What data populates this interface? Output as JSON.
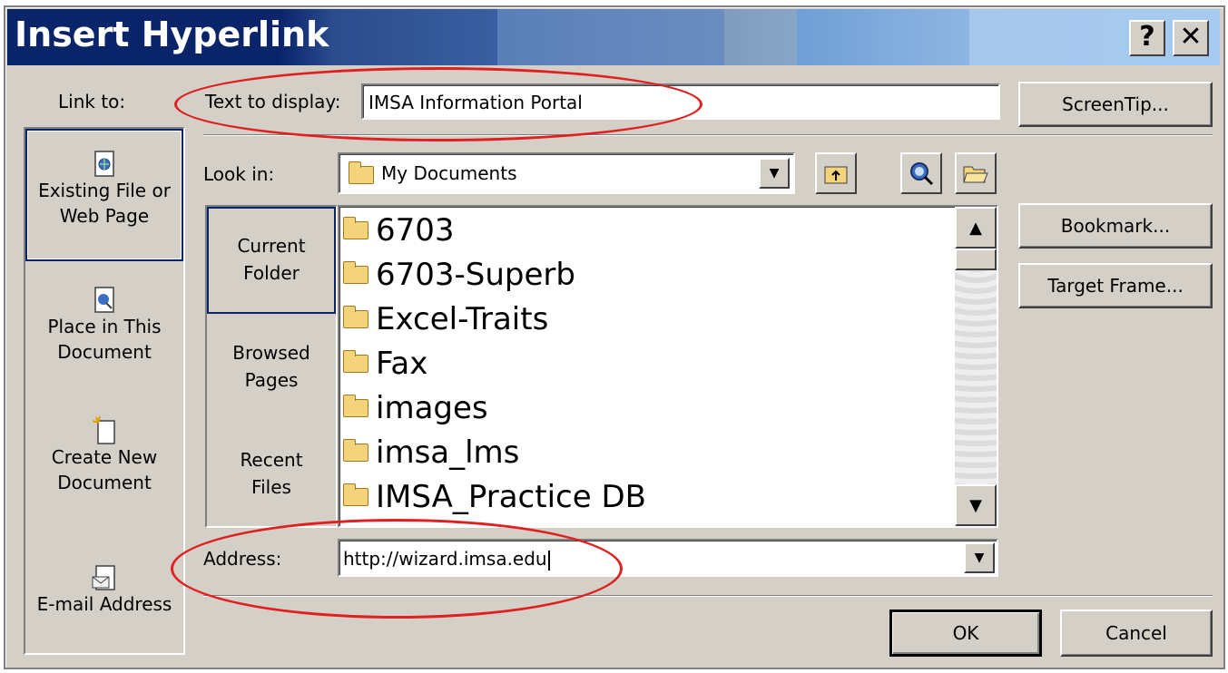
{
  "window": {
    "title": "Insert Hyperlink",
    "help_button": "?",
    "close_button": "✕"
  },
  "link_to": {
    "label": "Link to:",
    "items": [
      {
        "line1": "Existing File or",
        "line2": "Web Page",
        "icon": "web-page-icon",
        "selected": true
      },
      {
        "line1": "Place in This",
        "line2": "Document",
        "icon": "place-in-document-icon",
        "selected": false
      },
      {
        "line1": "Create New",
        "line2": "Document",
        "icon": "new-document-icon",
        "selected": false
      },
      {
        "line1": "E-mail Address",
        "line2": "",
        "icon": "email-icon",
        "selected": false
      }
    ]
  },
  "text_to_display": {
    "label": "Text to display:",
    "value": "IMSA Information Portal"
  },
  "look_in": {
    "label": "Look in:",
    "value": "My Documents"
  },
  "nav": {
    "items": [
      {
        "line1": "Current",
        "line2": "Folder",
        "selected": true
      },
      {
        "line1": "Browsed",
        "line2": "Pages",
        "selected": false
      },
      {
        "line1": "Recent",
        "line2": "Files",
        "selected": false
      }
    ]
  },
  "files": [
    "6703",
    "6703-Superb",
    "Excel-Traits",
    "Fax",
    "images",
    "imsa_lms",
    "IMSA_Practice DB"
  ],
  "address": {
    "label": "Address:",
    "value": "http://wizard.imsa.edu"
  },
  "buttons": {
    "screentip": "ScreenTip...",
    "bookmark": "Bookmark...",
    "target_frame": "Target Frame...",
    "ok": "OK",
    "cancel": "Cancel"
  },
  "colors": {
    "annotation": "#e02020",
    "titlebar": "#0a246a"
  }
}
